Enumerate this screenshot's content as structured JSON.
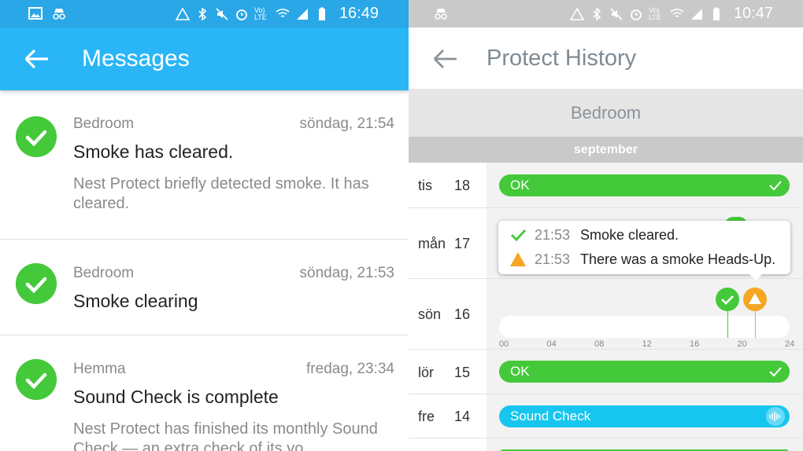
{
  "left": {
    "status": {
      "time": "16:49",
      "volte": "Vo) LTE"
    },
    "appbar": {
      "title": "Messages"
    },
    "messages": [
      {
        "location": "Bedroom",
        "date": "söndag, 21:54",
        "headline": "Smoke has cleared.",
        "body": "Nest Protect briefly detected smoke. It has cleared."
      },
      {
        "location": "Bedroom",
        "date": "söndag, 21:53",
        "headline": "Smoke clearing",
        "body": ""
      },
      {
        "location": "Hemma",
        "date": "fredag, 23:34",
        "headline": "Sound Check is complete",
        "body": "Nest Protect has finished its monthly Sound Check — an extra check of its vo"
      }
    ]
  },
  "right": {
    "status": {
      "time": "10:47",
      "volte": "Vo) LTE"
    },
    "appbar": {
      "title": "Protect History"
    },
    "location": "Bedroom",
    "month": "september",
    "days": [
      {
        "day": "tis",
        "num": "18",
        "event": "OK",
        "type": "ok"
      },
      {
        "day": "mån",
        "num": "17",
        "event": "",
        "type": "tooltip"
      },
      {
        "day": "sön",
        "num": "16",
        "event": "",
        "type": "timeline"
      },
      {
        "day": "lör",
        "num": "15",
        "event": "OK",
        "type": "ok"
      },
      {
        "day": "fre",
        "num": "14",
        "event": "Sound Check",
        "type": "sound"
      }
    ],
    "timeline_ticks": [
      "00",
      "04",
      "08",
      "12",
      "16",
      "20",
      "24"
    ],
    "tooltip": [
      {
        "time": "21:53",
        "text": "Smoke cleared.",
        "icon": "check-icon"
      },
      {
        "time": "21:53",
        "text": "There was a smoke Heads-Up.",
        "icon": "warning-icon"
      }
    ]
  },
  "colors": {
    "green": "#44c93a",
    "blue_bar": "#2ab6f6",
    "sound_cyan": "#17c6ef",
    "warning": "#f5a623"
  }
}
